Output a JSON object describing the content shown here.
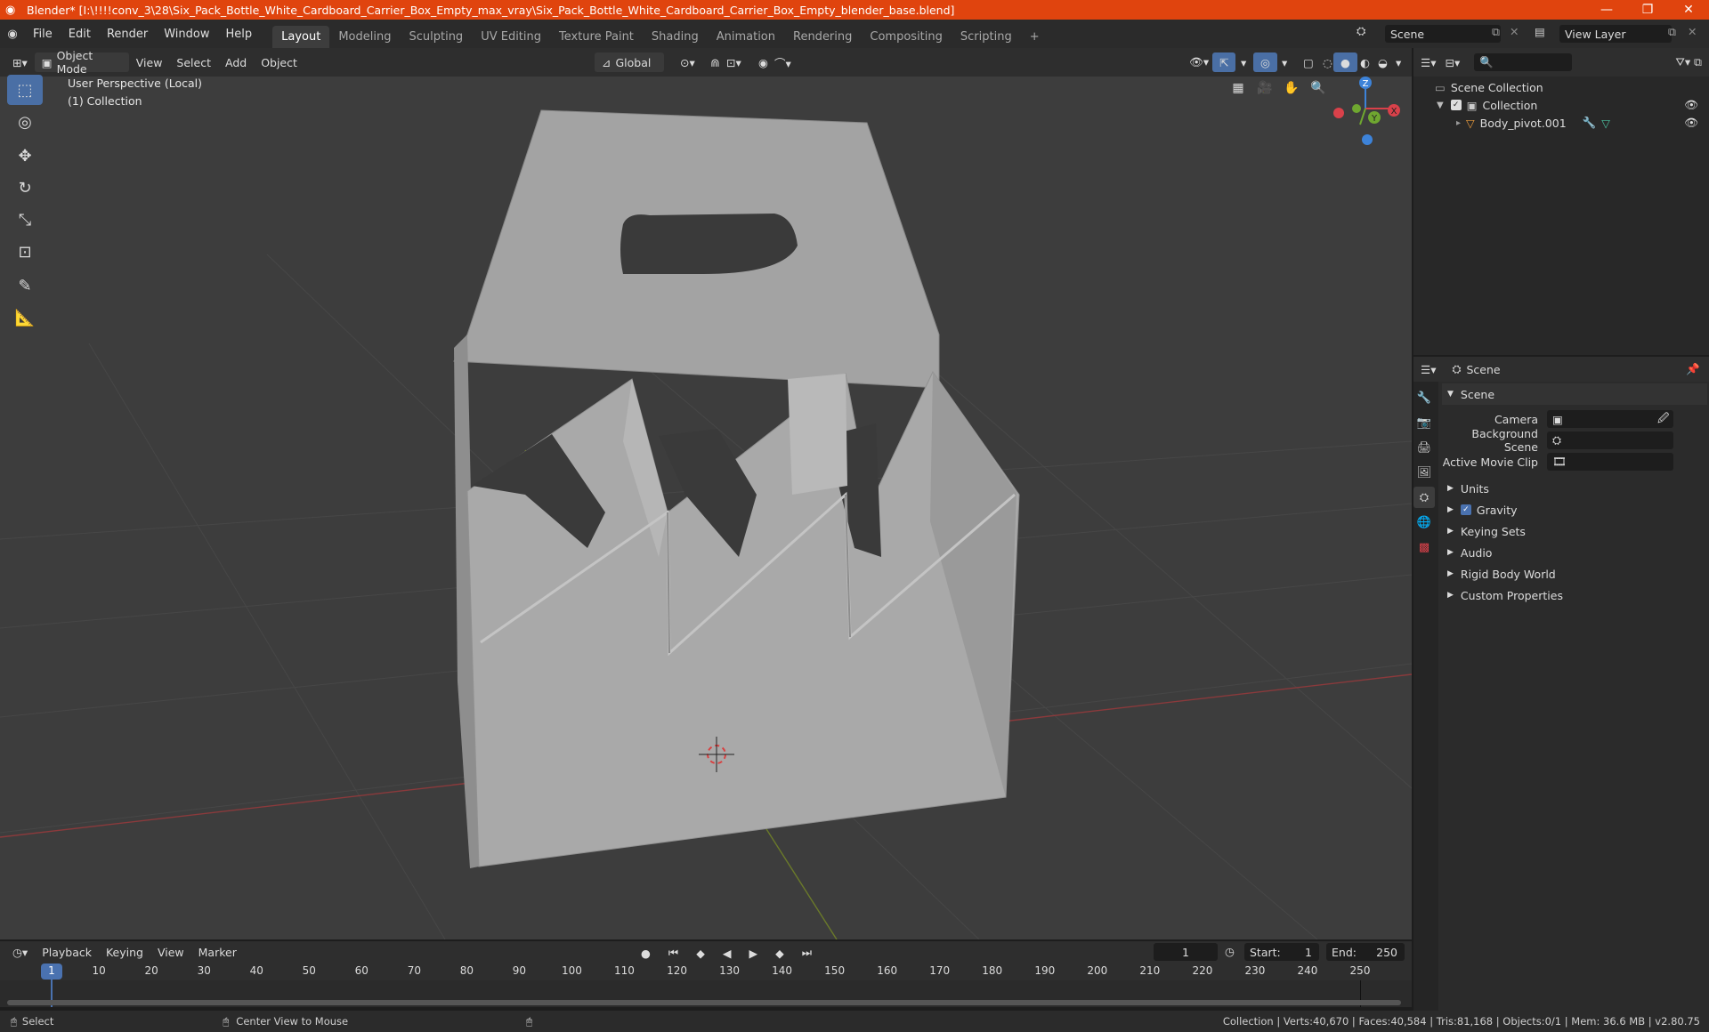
{
  "window": {
    "title": "Blender* [I:\\!!!!conv_3\\28\\Six_Pack_Bottle_White_Cardboard_Carrier_Box_Empty_max_vray\\Six_Pack_Bottle_White_Cardboard_Carrier_Box_Empty_blender_base.blend]",
    "minimize": "—",
    "restore": "❐",
    "close": "✕"
  },
  "menus": [
    "File",
    "Edit",
    "Render",
    "Window",
    "Help"
  ],
  "workspaces": [
    "Layout",
    "Modeling",
    "Sculpting",
    "UV Editing",
    "Texture Paint",
    "Shading",
    "Animation",
    "Rendering",
    "Compositing",
    "Scripting"
  ],
  "add_workspace": "+",
  "scene_field": "Scene",
  "view_layer_field": "View Layer",
  "viewport_header": {
    "mode": "Object Mode",
    "menus": [
      "View",
      "Select",
      "Add",
      "Object"
    ],
    "orientation": "Global"
  },
  "viewport": {
    "perspective": "User Perspective (Local)",
    "collection": "(1) Collection",
    "axis_x": "X",
    "axis_y": "Y",
    "axis_z": "Z"
  },
  "outliner": {
    "root": "Scene Collection",
    "collection": "Collection",
    "object": "Body_pivot.001"
  },
  "properties": {
    "header": "Scene",
    "section": "Scene",
    "fields": [
      {
        "label": "Camera",
        "value": ""
      },
      {
        "label": "Background Scene",
        "value": ""
      },
      {
        "label": "Active Movie Clip",
        "value": ""
      }
    ],
    "panels": [
      "Units",
      "Gravity",
      "Keying Sets",
      "Audio",
      "Rigid Body World",
      "Custom Properties"
    ]
  },
  "timeline": {
    "menus": [
      "Playback",
      "Keying",
      "View",
      "Marker"
    ],
    "current_frame": "1",
    "start_label": "Start:",
    "start": "1",
    "end_label": "End:",
    "end": "250",
    "ticks": [
      "1",
      "10",
      "20",
      "30",
      "40",
      "50",
      "60",
      "70",
      "80",
      "90",
      "100",
      "110",
      "120",
      "130",
      "140",
      "150",
      "160",
      "170",
      "180",
      "190",
      "200",
      "210",
      "220",
      "230",
      "240",
      "250"
    ]
  },
  "statusbar": {
    "left": "Select",
    "middle": "Center View to Mouse",
    "stats": "Collection | Verts:40,670 | Faces:40,584 | Tris:81,168 | Objects:0/1 | Mem: 36.6 MB | v2.80.75"
  },
  "colors": {
    "titlebar": "#e0440e",
    "viewport_bg": "#3d3d3d",
    "accent": "#4a72b0",
    "x_axis": "#d9414a",
    "y_axis": "#6fa730",
    "z_axis": "#3d83d9"
  }
}
